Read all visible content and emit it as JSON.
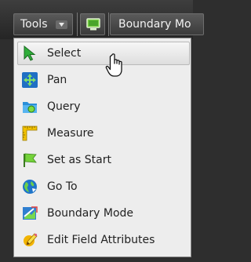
{
  "toolbar": {
    "tools_label": "Tools",
    "boundary_label": "Boundary Mo"
  },
  "menu": {
    "items": [
      {
        "label": "Select",
        "icon": "select-arrow-icon"
      },
      {
        "label": "Pan",
        "icon": "pan-arrows-icon"
      },
      {
        "label": "Query",
        "icon": "query-folder-icon"
      },
      {
        "label": "Measure",
        "icon": "ruler-icon"
      },
      {
        "label": "Set as Start",
        "icon": "flag-icon"
      },
      {
        "label": "Go To",
        "icon": "globe-icon"
      },
      {
        "label": "Boundary Mode",
        "icon": "boundary-map-icon"
      },
      {
        "label": "Edit Field Attributes",
        "icon": "pencil-edit-icon"
      }
    ],
    "highlighted_index": 0
  }
}
